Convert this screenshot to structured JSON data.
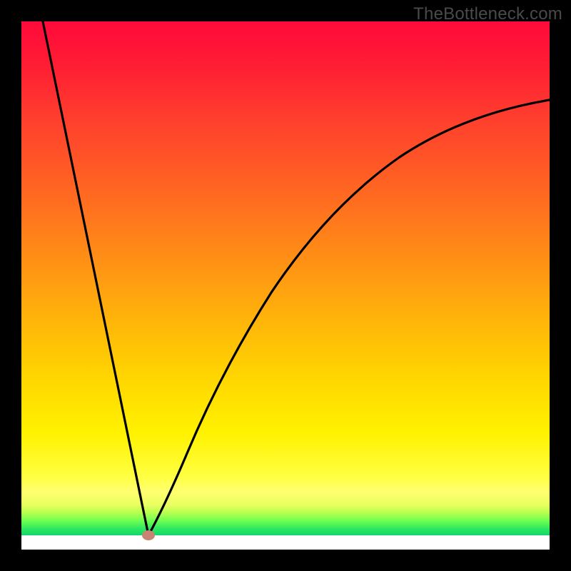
{
  "watermark": "TheBottleneck.com",
  "chart_data": {
    "type": "line",
    "x": [
      0.04,
      0.24,
      1.0
    ],
    "y_base": [
      1.0,
      0.0,
      0.82
    ],
    "title": "",
    "xlabel": "",
    "ylabel": "",
    "xlim": [
      0,
      1
    ],
    "ylim": [
      0,
      1
    ],
    "curve": {
      "min_x": 0.24,
      "left_slope_x0": 0.04,
      "right_end_y": 0.82
    },
    "marker": {
      "x": 0.24,
      "y": 0.015,
      "color": "#c98270"
    },
    "gradient_stops": [
      {
        "pos": 0.0,
        "color": "#ff0a3a"
      },
      {
        "pos": 0.5,
        "color": "#ff9912"
      },
      {
        "pos": 0.8,
        "color": "#ffff40"
      },
      {
        "pos": 0.95,
        "color": "#30e860"
      },
      {
        "pos": 0.98,
        "color": "#ffffff"
      }
    ]
  }
}
